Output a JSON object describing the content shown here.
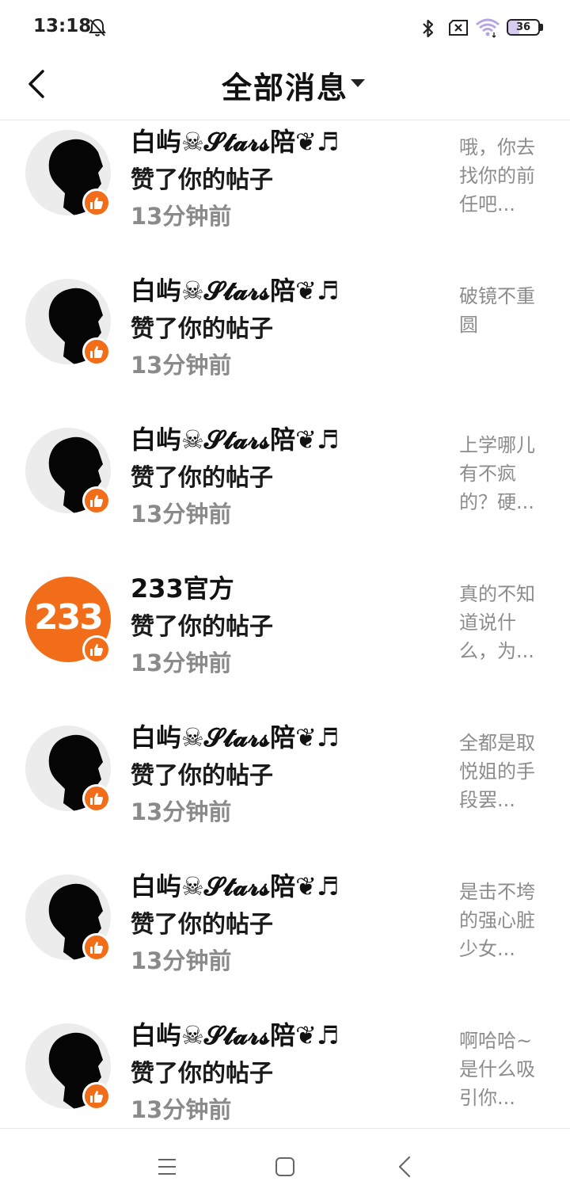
{
  "status_bar": {
    "time": "13:18",
    "battery_level": "36"
  },
  "header": {
    "title": "全部消息"
  },
  "items": [
    {
      "name": "白屿☠𝓢𝓽𝓪𝓻𝓼陪❦♬",
      "action": "赞了你的帖子",
      "time": "13分钟前",
      "snippet": "哦，你去\n找你的前\n任吧..."
    },
    {
      "name": "白屿☠𝓢𝓽𝓪𝓻𝓼陪❦♬",
      "action": "赞了你的帖子",
      "time": "13分钟前",
      "snippet": "破镜不重\n圆"
    },
    {
      "name": "白屿☠𝓢𝓽𝓪𝓻𝓼陪❦♬",
      "action": "赞了你的帖子",
      "time": "13分钟前",
      "snippet": "上学哪儿\n有不疯\n的？硬..."
    },
    {
      "name": "233官方",
      "action": "赞了你的帖子",
      "time": "13分钟前",
      "snippet": "真的不知\n道说什\n么，为...",
      "avatar_text": "233"
    },
    {
      "name": "白屿☠𝓢𝓽𝓪𝓻𝓼陪❦♬",
      "action": "赞了你的帖子",
      "time": "13分钟前",
      "snippet": "全都是取\n悦姐的手\n段罢..."
    },
    {
      "name": "白屿☠𝓢𝓽𝓪𝓻𝓼陪❦♬",
      "action": "赞了你的帖子",
      "time": "13分钟前",
      "snippet": "是击不垮\n的强心脏\n少女..."
    },
    {
      "name": "白屿☠𝓢𝓽𝓪𝓻𝓼陪❦♬",
      "action": "赞了你的帖子",
      "time": "13分钟前",
      "snippet": "啊哈哈~\n是什么吸\n引你..."
    }
  ],
  "icons": {
    "avatar_badge": "thumbs-up-icon",
    "nav": [
      "menu-icon",
      "home-square-icon",
      "back-triangle-icon"
    ]
  },
  "colors": {
    "accent": "#f26d1a",
    "secondary_text": "#8a8a8a"
  }
}
